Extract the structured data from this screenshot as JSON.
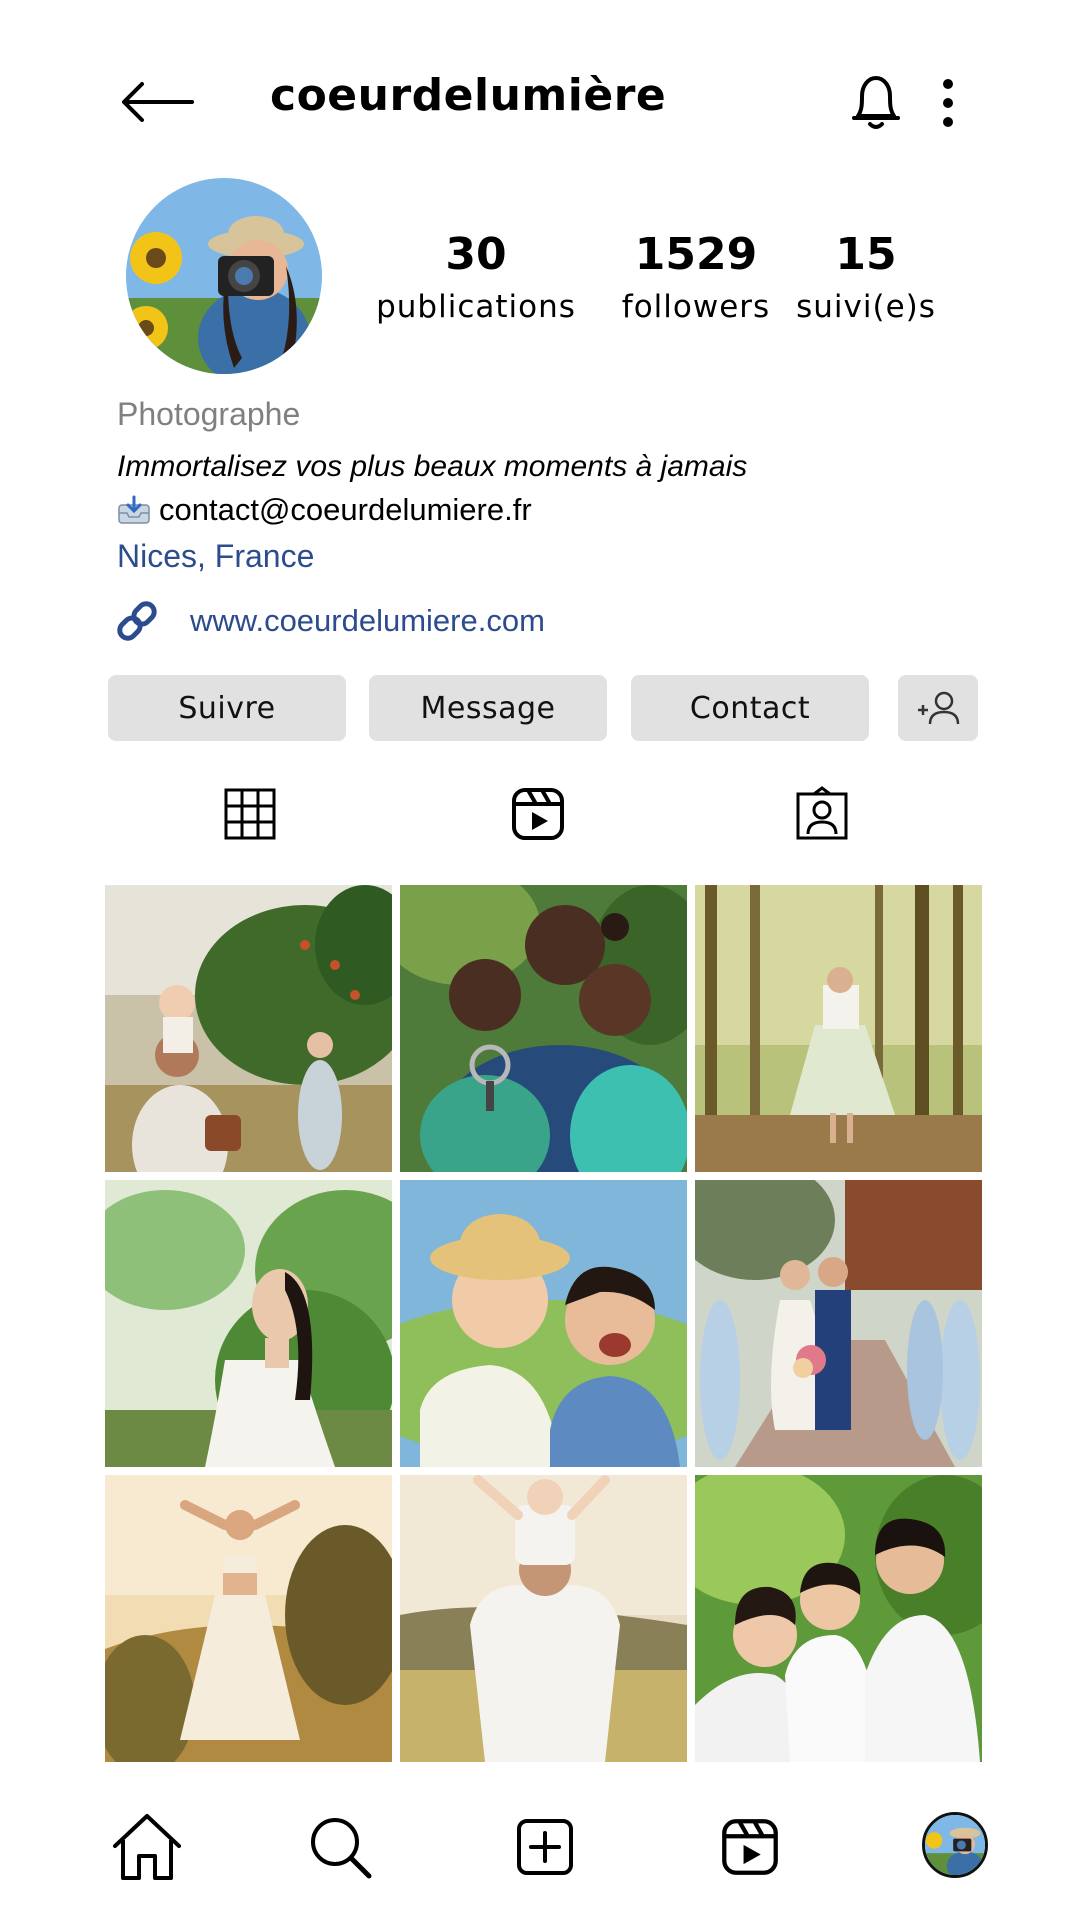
{
  "header": {
    "username": "coeurdelumière",
    "icons": [
      "arrow-left-icon",
      "bell-icon",
      "more-vertical-icon"
    ]
  },
  "profile": {
    "stats": [
      {
        "value": "30",
        "label": "publications"
      },
      {
        "value": "1529",
        "label": "followers"
      },
      {
        "value": "15",
        "label": "suivi(e)s"
      }
    ],
    "category": "Photographe",
    "bio": "Immortalisez vos plus beaux moments à jamais",
    "email": "contact@coeurdelumiere.fr",
    "location": "Nices, France",
    "website": "www.coeurdelumiere.com"
  },
  "actions": {
    "follow": "Suivre",
    "message": "Message",
    "contact": "Contact"
  },
  "tabs": [
    "grid-icon",
    "reels-icon",
    "tagged-icon"
  ],
  "posts": [
    "family-orchard-photo",
    "father-kids-magnifier-photo",
    "woman-forest-photo",
    "woman-trees-photo",
    "children-laughing-photo",
    "wedding-couple-photo",
    "woman-sunset-field-photo",
    "father-child-shoulders-photo",
    "family-hug-photo"
  ],
  "bottom_nav": [
    "home-icon",
    "search-icon",
    "add-post-icon",
    "reels-icon",
    "profile-avatar"
  ],
  "colors": {
    "link": "#2c4c8e",
    "button_bg": "#e1e1e1",
    "muted": "#808080"
  }
}
